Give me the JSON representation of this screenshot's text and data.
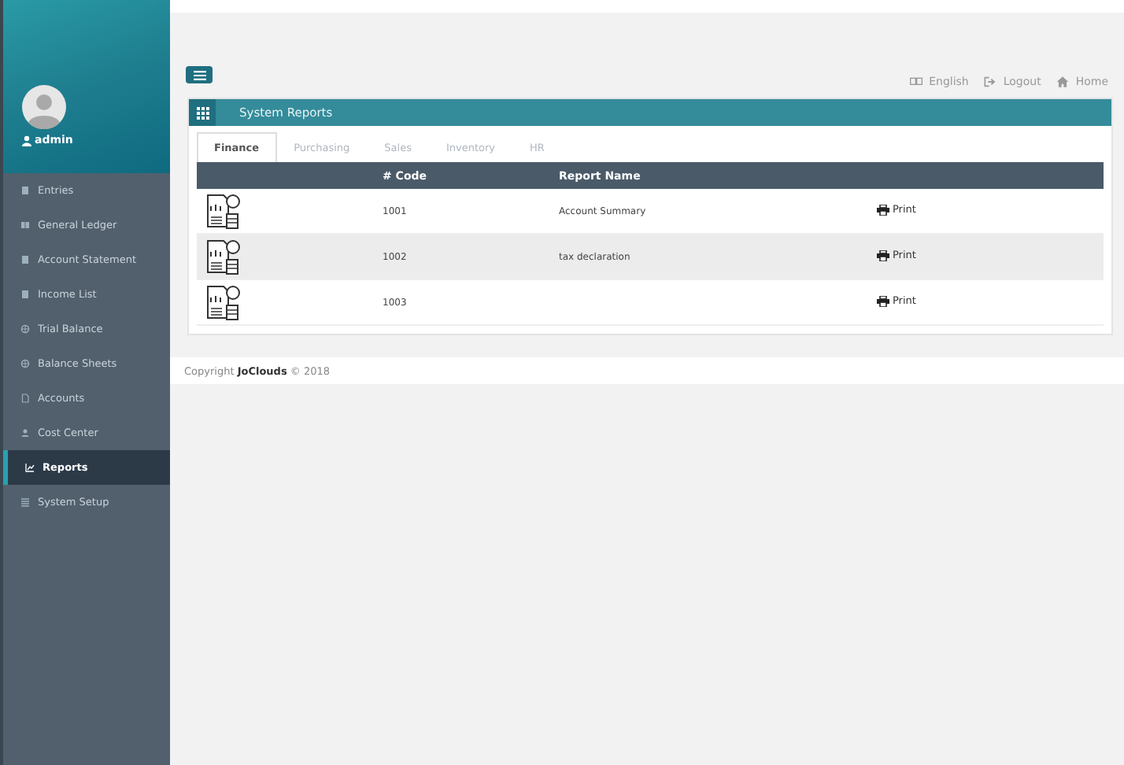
{
  "sidebar": {
    "user": "admin",
    "items": [
      {
        "label": "Entries",
        "selected": false
      },
      {
        "label": "General Ledger",
        "selected": false
      },
      {
        "label": "Account Statement",
        "selected": false
      },
      {
        "label": "Income List",
        "selected": false
      },
      {
        "label": "Trial Balance",
        "selected": false
      },
      {
        "label": "Balance Sheets",
        "selected": false
      },
      {
        "label": "Accounts",
        "selected": false
      },
      {
        "label": "Cost Center",
        "selected": false
      },
      {
        "label": "Reports",
        "selected": true
      },
      {
        "label": "System Setup",
        "selected": false
      }
    ]
  },
  "top_links": [
    "English",
    "Logout",
    "Home"
  ],
  "panel": {
    "title": "System Reports",
    "tabs": [
      {
        "label": "Finance",
        "selected": true
      },
      {
        "label": "Purchasing",
        "selected": false
      },
      {
        "label": "Sales",
        "selected": false
      },
      {
        "label": "Inventory",
        "selected": false
      },
      {
        "label": "HR",
        "selected": false
      }
    ],
    "table": {
      "columns": [
        "# Code",
        "Report Name"
      ],
      "rows": [
        {
          "code": "1001",
          "name": "Account Summary",
          "action": "Print"
        },
        {
          "code": "1002",
          "name": "tax declaration",
          "action": "Print"
        },
        {
          "code": "1003",
          "action": "Print"
        }
      ]
    }
  },
  "footer": "Copyright **JoClouds** © 2018"
}
